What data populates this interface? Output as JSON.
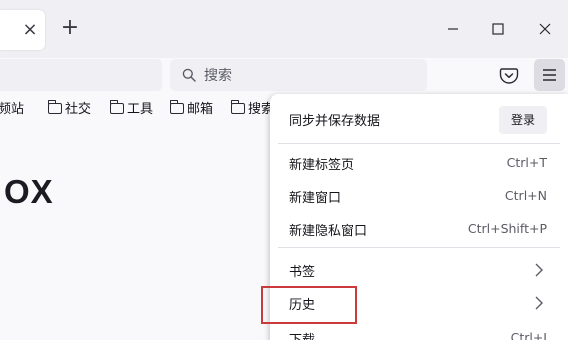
{
  "tabs": {
    "close_glyph": "×",
    "new_tab_glyph": "+"
  },
  "window_controls": {
    "icons": [
      "minimize-icon",
      "maximize-icon",
      "close-icon"
    ]
  },
  "toolbar": {
    "search_placeholder": "搜索",
    "icons": [
      "search-icon",
      "pocket-icon",
      "hamburger-menu-icon"
    ]
  },
  "bookmarks": [
    {
      "label": "频站",
      "icon": "none"
    },
    {
      "label": "社交",
      "icon": "folder-icon"
    },
    {
      "label": "工具",
      "icon": "folder-icon"
    },
    {
      "label": "邮箱",
      "icon": "folder-icon"
    },
    {
      "label": "搜索",
      "icon": "folder-icon"
    }
  ],
  "content": {
    "logo_text": "OX"
  },
  "menu": {
    "sync_label": "同步并保存数据",
    "login_label": "登录",
    "items": [
      {
        "label": "新建标签页",
        "shortcut": "Ctrl+T"
      },
      {
        "label": "新建窗口",
        "shortcut": "Ctrl+N"
      },
      {
        "label": "新建隐私窗口",
        "shortcut": "Ctrl+Shift+P"
      }
    ],
    "submenus": [
      {
        "label": "书签",
        "icon": "chevron-right-icon"
      },
      {
        "label": "历史",
        "icon": "chevron-right-icon"
      }
    ],
    "downloads": {
      "label": "下载",
      "shortcut": "Ctrl+J"
    }
  },
  "colors": {
    "highlight_border": "#cc3b3b",
    "menu_bg": "#ffffff",
    "tabstrip_bg": "#f0f0f4"
  }
}
